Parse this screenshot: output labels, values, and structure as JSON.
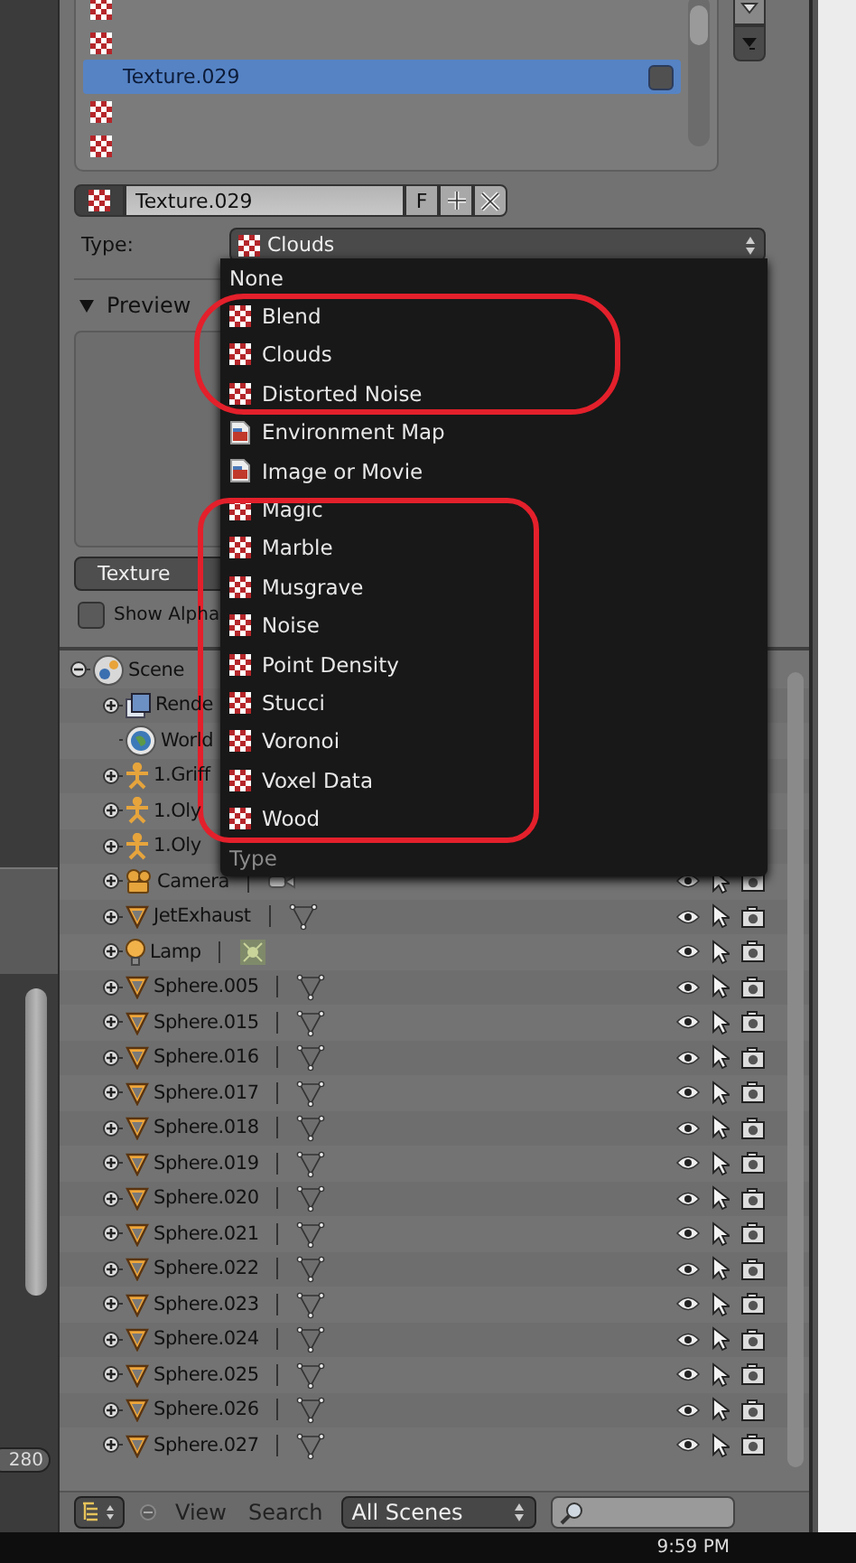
{
  "texture_slots": [
    {
      "selected": false
    },
    {
      "selected": false
    },
    {
      "name": "Texture.029",
      "selected": true
    },
    {
      "selected": false
    },
    {
      "selected": false
    }
  ],
  "texture_name": {
    "value": "Texture.029",
    "fake_user": "F"
  },
  "type_field": {
    "label": "Type:",
    "value": "Clouds"
  },
  "preview": {
    "title": "Preview",
    "expanded": true
  },
  "tabs": [
    {
      "label": "Texture",
      "selected": false
    }
  ],
  "show_alpha": {
    "label": "Show Alpha",
    "checked": false
  },
  "outliner": {
    "tree": [
      {
        "name": "Scene",
        "kind": "scene",
        "expanded": true,
        "children": [
          {
            "name": "Rende",
            "kind": "render_layers",
            "expanded": false
          },
          {
            "name": "World",
            "kind": "world"
          },
          {
            "name": "1.Griff",
            "kind": "armature",
            "expanded": false
          },
          {
            "name": "1.Oly",
            "kind": "armature",
            "expanded": false
          },
          {
            "name": "1.Oly",
            "kind": "armature",
            "expanded": false
          },
          {
            "name": "Camera",
            "kind": "camera",
            "expanded": false,
            "restrict": true
          },
          {
            "name": "JetExhaust",
            "kind": "mesh",
            "expanded": false,
            "restrict": true
          },
          {
            "name": "Lamp",
            "kind": "lamp",
            "expanded": false,
            "restrict": true
          },
          {
            "name": "Sphere.005",
            "kind": "mesh",
            "expanded": false,
            "restrict": true
          },
          {
            "name": "Sphere.015",
            "kind": "mesh",
            "expanded": false,
            "restrict": true
          },
          {
            "name": "Sphere.016",
            "kind": "mesh",
            "expanded": false,
            "restrict": true
          },
          {
            "name": "Sphere.017",
            "kind": "mesh",
            "expanded": false,
            "restrict": true
          },
          {
            "name": "Sphere.018",
            "kind": "mesh",
            "expanded": false,
            "restrict": true
          },
          {
            "name": "Sphere.019",
            "kind": "mesh",
            "expanded": false,
            "restrict": true
          },
          {
            "name": "Sphere.020",
            "kind": "mesh",
            "expanded": false,
            "restrict": true
          },
          {
            "name": "Sphere.021",
            "kind": "mesh",
            "expanded": false,
            "restrict": true
          },
          {
            "name": "Sphere.022",
            "kind": "mesh",
            "expanded": false,
            "restrict": true
          },
          {
            "name": "Sphere.023",
            "kind": "mesh",
            "expanded": false,
            "restrict": true
          },
          {
            "name": "Sphere.024",
            "kind": "mesh",
            "expanded": false,
            "restrict": true
          },
          {
            "name": "Sphere.025",
            "kind": "mesh",
            "expanded": false,
            "restrict": true
          },
          {
            "name": "Sphere.026",
            "kind": "mesh",
            "expanded": false,
            "restrict": true
          },
          {
            "name": "Sphere.027",
            "kind": "mesh",
            "expanded": false,
            "restrict": true
          }
        ]
      }
    ]
  },
  "outliner_header": {
    "menus": [
      "View",
      "Search"
    ],
    "display": "All Scenes"
  },
  "type_menu": {
    "title": "Type",
    "items": [
      {
        "label": "None",
        "kind": "none"
      },
      {
        "label": "Blend",
        "kind": "texture"
      },
      {
        "label": "Clouds",
        "kind": "texture"
      },
      {
        "label": "Distorted Noise",
        "kind": "texture"
      },
      {
        "label": "Environment Map",
        "kind": "image"
      },
      {
        "label": "Image or Movie",
        "kind": "image"
      },
      {
        "label": "Magic",
        "kind": "texture"
      },
      {
        "label": "Marble",
        "kind": "texture"
      },
      {
        "label": "Musgrave",
        "kind": "texture"
      },
      {
        "label": "Noise",
        "kind": "texture"
      },
      {
        "label": "Point Density",
        "kind": "texture"
      },
      {
        "label": "Stucci",
        "kind": "texture"
      },
      {
        "label": "Voronoi",
        "kind": "texture"
      },
      {
        "label": "Voxel Data",
        "kind": "texture"
      },
      {
        "label": "Wood",
        "kind": "texture"
      }
    ]
  },
  "left_area": {
    "frame_field": "280"
  },
  "taskbar": {
    "clock": "9:59 PM"
  }
}
